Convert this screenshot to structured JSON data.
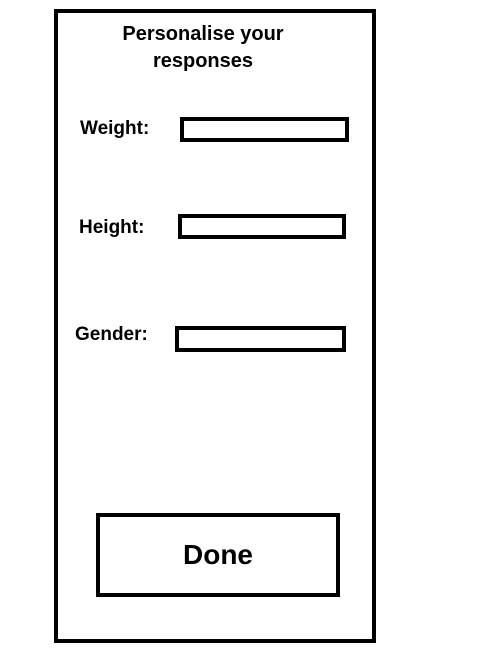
{
  "screen": {
    "title": "Personalise your responses"
  },
  "form": {
    "fields": [
      {
        "label": "Weight:",
        "value": "",
        "placeholder": ""
      },
      {
        "label": "Height:",
        "value": "",
        "placeholder": ""
      },
      {
        "label": "Gender:",
        "value": "",
        "placeholder": ""
      }
    ]
  },
  "actions": {
    "done_label": "Done"
  },
  "colors": {
    "border": "#000000",
    "background": "#ffffff",
    "text": "#000000"
  }
}
